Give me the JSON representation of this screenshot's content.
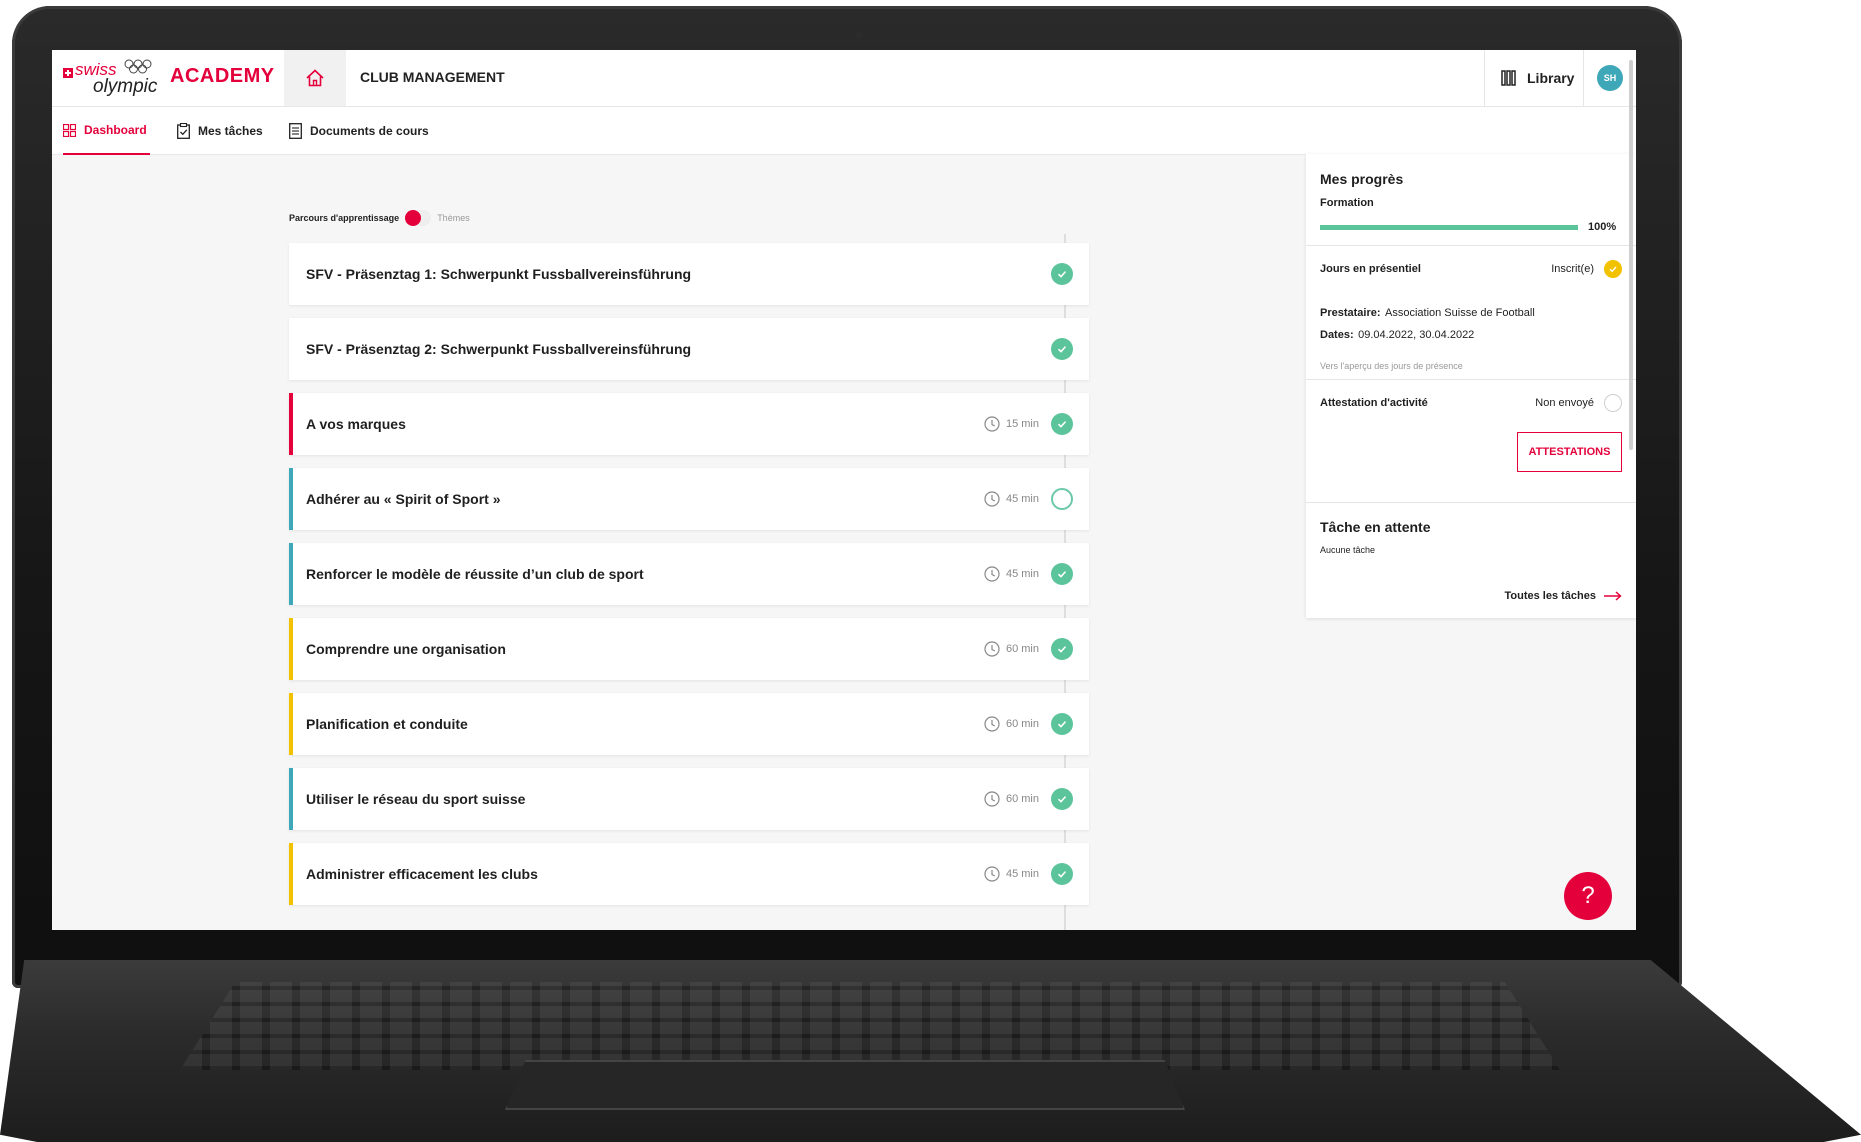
{
  "brand": {
    "swiss": "swiss",
    "olympic": "olympic",
    "academy": "ACADEMY",
    "accent_color": "#e4003a"
  },
  "header": {
    "title": "CLUB MANAGEMENT",
    "library_label": "Library",
    "avatar_initials": "SH"
  },
  "nav": {
    "items": [
      {
        "label": "Dashboard",
        "icon": "grid-icon",
        "active": true
      },
      {
        "label": "Mes tâches",
        "icon": "clipboard-check-icon",
        "active": false
      },
      {
        "label": "Documents de cours",
        "icon": "document-icon",
        "active": false
      }
    ]
  },
  "toggle": {
    "left_label": "Parcours d'apprentissage",
    "right_label": "Thèmes"
  },
  "courses": [
    {
      "title": "SFV - Präsenztag 1: Schwerpunkt Fussballvereinsführung",
      "duration": "",
      "status": "done",
      "accent": ""
    },
    {
      "title": "SFV - Präsenztag 2: Schwerpunkt Fussballvereinsführung",
      "duration": "",
      "status": "done",
      "accent": ""
    },
    {
      "title": "A vos marques",
      "duration": "15 min",
      "status": "done",
      "accent": "#e4003a"
    },
    {
      "title": "Adhérer au « Spirit of Sport »",
      "duration": "45 min",
      "status": "pending",
      "accent": "#3ea7b8"
    },
    {
      "title": "Renforcer le modèle de réussite d’un club de sport",
      "duration": "45 min",
      "status": "done",
      "accent": "#3ea7b8"
    },
    {
      "title": "Comprendre une organisation",
      "duration": "60 min",
      "status": "done",
      "accent": "#f2c200"
    },
    {
      "title": "Planification et conduite",
      "duration": "60 min",
      "status": "done",
      "accent": "#f2c200"
    },
    {
      "title": "Utiliser le réseau du sport suisse",
      "duration": "60 min",
      "status": "done",
      "accent": "#3ea7b8"
    },
    {
      "title": "Administrer efficacement les clubs",
      "duration": "45 min",
      "status": "done",
      "accent": "#f2c200"
    }
  ],
  "panel": {
    "progress": {
      "title": "Mes progrès",
      "label": "Formation",
      "percent_text": "100%",
      "value": 1.0,
      "color": "#5cc49a"
    },
    "presence": {
      "title": "Jours en présentiel",
      "status": "Inscrit(e)",
      "provider_label": "Prestataire:",
      "provider": "Association Suisse de Football",
      "dates_label": "Dates:",
      "dates": "09.04.2022, 30.04.2022",
      "link": "Vers l'aperçu des jours de présence"
    },
    "attestation": {
      "title": "Attestation d'activité",
      "status": "Non envoyé",
      "button": "ATTESTATIONS"
    },
    "tasks": {
      "title": "Tâche en attente",
      "empty": "Aucune tâche",
      "link": "Toutes les tâches"
    }
  },
  "help": {
    "label": "?"
  }
}
